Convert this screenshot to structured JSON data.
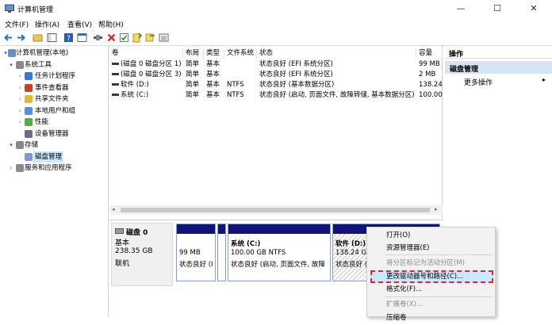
{
  "window": {
    "title": "计算机管理",
    "minimize": "—",
    "maximize": "☐",
    "close": "✕"
  },
  "menubar": [
    "文件(F)",
    "操作(A)",
    "查看(V)",
    "帮助(H)"
  ],
  "tree": [
    {
      "label": "计算机管理(本地)",
      "icon": "computer-management-icon",
      "arrow": "▾",
      "level": 0
    },
    {
      "label": "系统工具",
      "icon": "tools-icon",
      "arrow": "▾",
      "level": 1
    },
    {
      "label": "任务计划程序",
      "icon": "task-scheduler-icon",
      "arrow": "›",
      "level": 2
    },
    {
      "label": "事件查看器",
      "icon": "event-viewer-icon",
      "arrow": "›",
      "level": 2
    },
    {
      "label": "共享文件夹",
      "icon": "shared-folder-icon",
      "arrow": "›",
      "level": 2
    },
    {
      "label": "本地用户和组",
      "icon": "users-icon",
      "arrow": "›",
      "level": 2
    },
    {
      "label": "性能",
      "icon": "performance-icon",
      "arrow": "›",
      "level": 2
    },
    {
      "label": "设备管理器",
      "icon": "device-manager-icon",
      "arrow": "",
      "level": 2
    },
    {
      "label": "存储",
      "icon": "storage-icon",
      "arrow": "▾",
      "level": 1
    },
    {
      "label": "磁盘管理",
      "icon": "disk-management-icon",
      "arrow": "",
      "level": 2,
      "selected": true
    },
    {
      "label": "服务和应用程序",
      "icon": "services-icon",
      "arrow": "›",
      "level": 1
    }
  ],
  "columns": [
    "卷",
    "布局",
    "类型",
    "文件系统",
    "状态",
    "容量"
  ],
  "volumes": [
    [
      "(磁盘 0 磁盘分区 1)",
      "简单",
      "基本",
      "",
      "状态良好 (EFI 系统分区)",
      "99 MB"
    ],
    [
      "(磁盘 0 磁盘分区 3)",
      "简单",
      "基本",
      "",
      "状态良好 (EFI 系统分区)",
      "2 MB"
    ],
    [
      "软件 (D:)",
      "简单",
      "基本",
      "NTFS",
      "状态良好 (基本数据分区)",
      "138.24"
    ],
    [
      "系统 (C:)",
      "简单",
      "基本",
      "NTFS",
      "状态良好 (启动, 页面文件, 故障转储, 基本数据分区)",
      "100.00"
    ]
  ],
  "disk": {
    "name": "磁盘 0",
    "type": "基本",
    "size": "238.35 GB",
    "status": "联机"
  },
  "partitions": [
    {
      "line1": "",
      "line2": "99 MB",
      "line3": "状态良好 (I"
    },
    {
      "line1": "",
      "line2": "",
      "line3": ""
    },
    {
      "line1": "系统  (C:)",
      "line2": "100.00 GB NTFS",
      "line3": "状态良好 (启动, 页面文件, 故障"
    },
    {
      "line1": "软件  (D:)",
      "line2": "138.24 GB",
      "line3": "状态良好 (基"
    }
  ],
  "actions": {
    "header": "操作",
    "section": "磁盘管理",
    "more": "更多操作",
    "more_arrow": "▸"
  },
  "context_menu": [
    {
      "label": "打开(O)",
      "disabled": false
    },
    {
      "label": "资源管理器(E)",
      "disabled": false
    },
    {
      "label": "将分区标记为活动分区(M)",
      "disabled": true
    },
    {
      "label": "更改驱动器号和路径(C)...",
      "disabled": false,
      "highlighted": true
    },
    {
      "label": "格式化(F)...",
      "disabled": false
    },
    {
      "label": "扩展卷(X)...",
      "disabled": true
    },
    {
      "label": "压缩卷",
      "disabled": false
    }
  ],
  "colors": {
    "partition_header": "#12127a",
    "selection": "#cce8ff",
    "highlight_border": "#d6283a"
  }
}
